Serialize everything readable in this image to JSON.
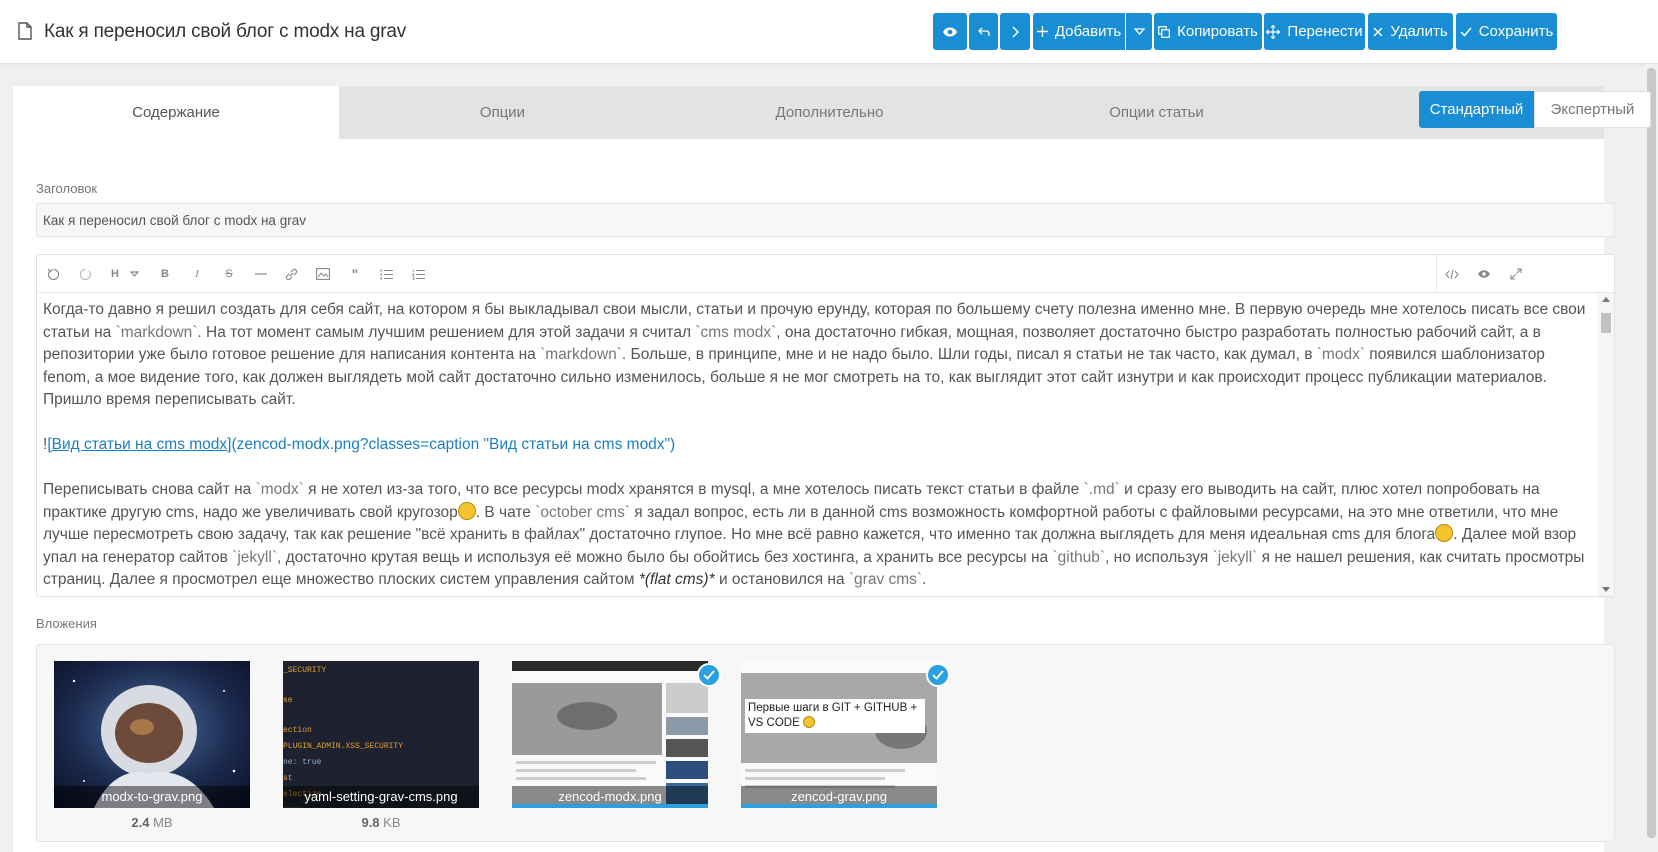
{
  "header": {
    "title": "Как я переносил свой блог с modx на grav",
    "buttons": {
      "add": "Добавить",
      "copy": "Копировать",
      "move": "Перенести",
      "delete": "Удалить",
      "save": "Сохранить"
    }
  },
  "tabs": [
    "Содержание",
    "Опции",
    "Дополнительно",
    "Опции статьи"
  ],
  "modes": {
    "standard": "Стандартный",
    "expert": "Экспертный"
  },
  "form": {
    "title_label": "Заголовок",
    "title_value": "Как я переносил свой блог с modx на grav",
    "attachments_label": "Вложения"
  },
  "editor": {
    "p1": {
      "a": "Когда-то давно я решил создать для себя сайт, на котором я бы выкладывал свои мысли, статьи и прочую ерунду, которая по большему счету полезна именно мне. В первую очередь мне хотелось писать все свои статьи на ",
      "c1": "`markdown`",
      "b": ". На тот момент самым лучшим решением для этой задачи я считал ",
      "c2": "`cms modx`",
      "c": ", она достаточно гибкая, мощная, позволяет достаточно быстро разработать полностью рабочий сайт, а в репозитории уже было готовое решение для написания контента на ",
      "c3": "`markdown`",
      "d": ". Больше, в принципе, мне и не надо было. Шли годы, писал я статьи не так часто, как думал, в ",
      "c4": "`modx`",
      "e": " появился шаблонизатор fenom, а мое видение того, как должен выглядеть мой сайт достаточно сильно изменилось, больше я не мог смотреть на то, как выглядит этот сайт изнутри и как происходит процесс публикации материалов. Пришло время переписывать сайт."
    },
    "img_line": {
      "bang": "!",
      "alt": "[Вид статьи на cms modx]",
      "src": "(zencod-modx.png?classes=caption \"Вид статьи на cms modx\")"
    },
    "p2": {
      "a": "Переписывать снова сайт на ",
      "c1": "`modx`",
      "b": " я не хотел из-за того, что все ресурсы modx хранятся в mysql, а мне хотелось писать текст статьи в файле ",
      "c2": "`.md`",
      "c": " и сразу его выводить на сайт, плюс хотел попробовать на практике другую cms, надо же увеличивать свой кругозор",
      "d": ". В чате ",
      "c3": "`october cms`",
      "e": " я задал вопрос, есть ли в данной cms возможность комфортной работы с файловыми ресурсами, на это мне ответили, что мне лучше пересмотреть свою задачу, так как решение \"всё хранить в файлах\" достаточно глупое. Но мне всё равно кажется, что именно так должна выглядеть для меня идеальная cms для блога",
      "f": ". Далее мой взор упал на генератор сайтов ",
      "c4": "`jekyll`",
      "g": ", достаточно крутая вещь и используя её можно было бы обойтись без хостинга, а хранить все ресурсы на ",
      "c5": "`github`",
      "h": ", но используя ",
      "c6": "`jekyll`",
      "i": " я не нашел решения, как считать просмотры страниц. Далее я просмотрел еще множество плоских систем управления сайтом ",
      "em": "*(flat cms)*",
      "j": " и остановился на ",
      "c7": "`grav cms`",
      "k": "."
    }
  },
  "attachments": [
    {
      "name": "modx-to-grav.png",
      "size_num": "2.4",
      "size_unit": " MB",
      "selected": false
    },
    {
      "name": "yaml-setting-grav-cms.png",
      "size_num": "9.8",
      "size_unit": " KB",
      "selected": false
    },
    {
      "name": "zencod-modx.png",
      "selected": true
    },
    {
      "name": "zencod-grav.png",
      "selected": true,
      "overlay_text": "Первые шаги в GIT + GITHUB + VS CODE"
    }
  ],
  "yaml_snippet": [
    "_SECURITY",
    "se",
    "ection",
    "PLUGIN_ADMIN.XSS_SECURITY",
    "ne: true",
    "st",
    "electize",
    "arge"
  ],
  "colors": {
    "accent": "#1a8ed4",
    "check": "#2aa0e0"
  }
}
